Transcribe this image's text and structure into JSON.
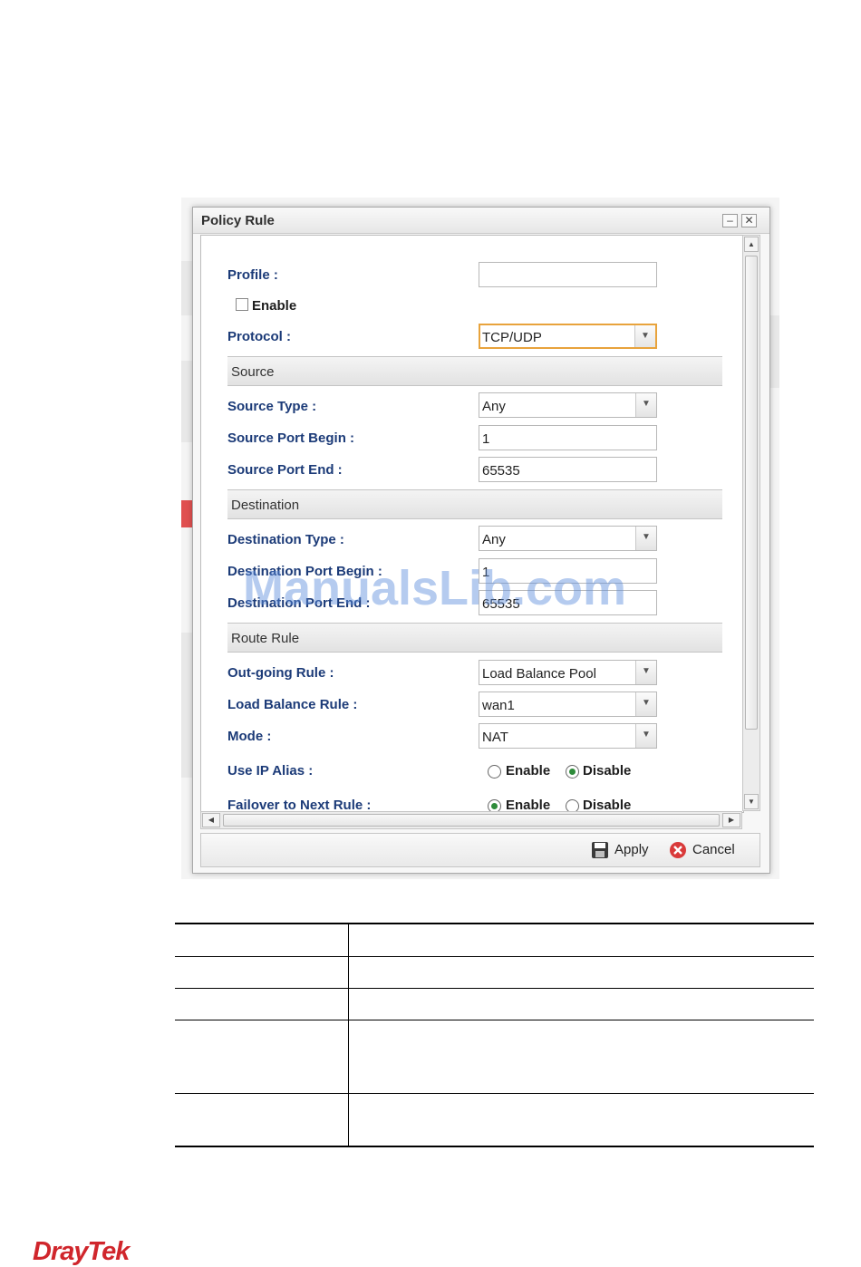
{
  "dialog": {
    "title": "Policy Rule",
    "minimize_glyph": "–",
    "close_glyph": "✕"
  },
  "form": {
    "profile_label": "Profile :",
    "profile_value": "",
    "enable_label": "Enable",
    "enable_checked": false,
    "protocol_label": "Protocol :",
    "protocol_value": "TCP/UDP",
    "source_section": "Source",
    "source_type_label": "Source Type :",
    "source_type_value": "Any",
    "source_port_begin_label": "Source Port Begin :",
    "source_port_begin_value": "1",
    "source_port_end_label": "Source Port End :",
    "source_port_end_value": "65535",
    "destination_section": "Destination",
    "destination_type_label": "Destination Type :",
    "destination_type_value": "Any",
    "destination_port_begin_label": "Destination Port Begin :",
    "destination_port_begin_value": "1",
    "destination_port_end_label": "Destination Port End :",
    "destination_port_end_value": "65535",
    "route_section": "Route Rule",
    "outgoing_rule_label": "Out-going Rule :",
    "outgoing_rule_value": "Load Balance Pool",
    "load_balance_rule_label": "Load Balance Rule :",
    "load_balance_rule_value": "wan1",
    "mode_label": "Mode :",
    "mode_value": "NAT",
    "use_ip_alias_label": "Use IP Alias :",
    "use_ip_alias_value": "Disable",
    "failover_label": "Failover to Next Rule :",
    "failover_value": "Enable",
    "radio_enable": "Enable",
    "radio_disable": "Disable"
  },
  "footer": {
    "apply_label": "Apply",
    "cancel_label": "Cancel"
  },
  "watermark": "ManualsLib.com",
  "brand": {
    "logo_text": "DrayTek",
    "color": "#d0262c"
  },
  "colors": {
    "label_blue": "#1c3b78",
    "focus_orange": "#e8a33c",
    "radio_green": "#2e8b3a"
  }
}
